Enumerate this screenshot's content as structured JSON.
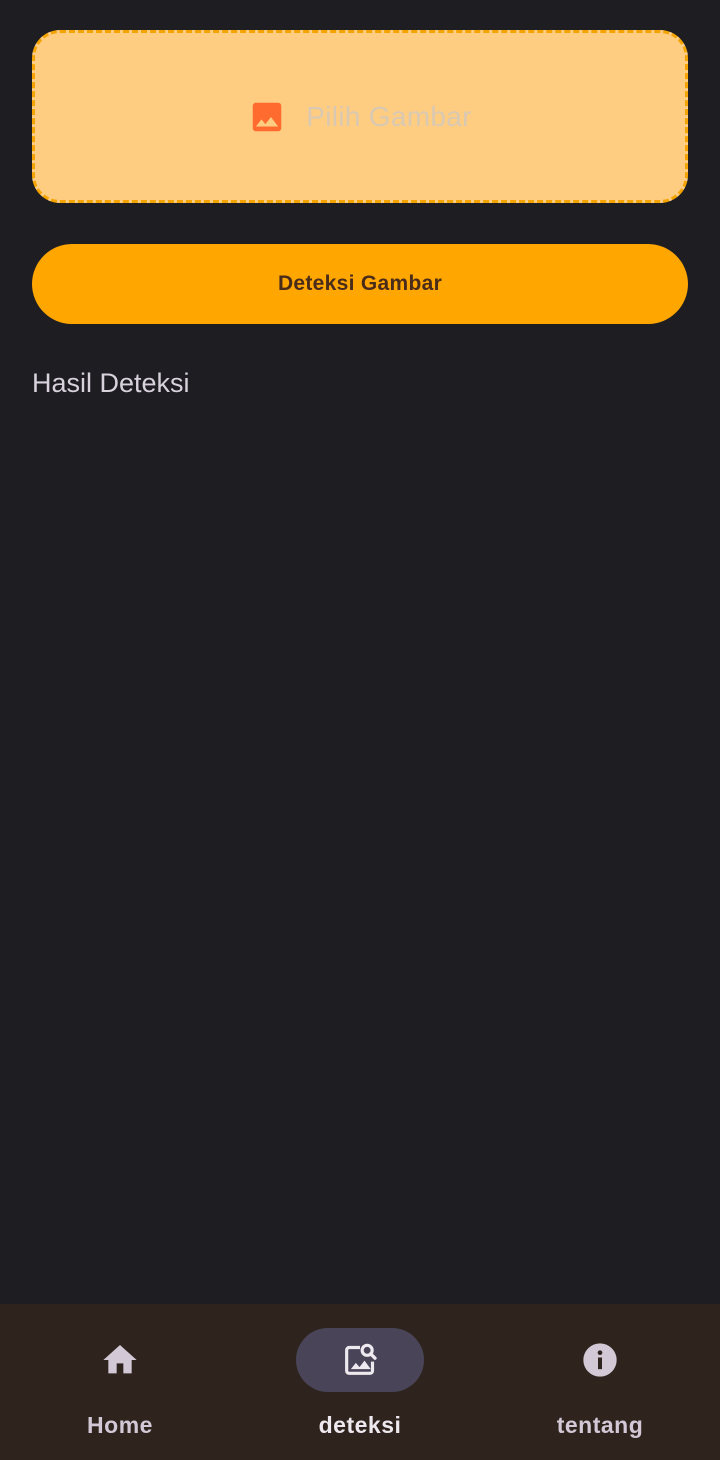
{
  "image_picker": {
    "icon": "image-icon",
    "label": "Pilih Gambar"
  },
  "detect_button": {
    "label": "Deteksi Gambar"
  },
  "result": {
    "title": "Hasil Deteksi"
  },
  "bottom_nav": {
    "items": [
      {
        "label": "Home",
        "icon": "home-icon",
        "active": false
      },
      {
        "label": "deteksi",
        "icon": "image-search-icon",
        "active": true
      },
      {
        "label": "tentang",
        "icon": "info-icon",
        "active": false
      }
    ]
  },
  "colors": {
    "background": "#1e1d22",
    "accent": "#ffa600",
    "picker_fill": "#ffcd82",
    "picker_border": "#f5a300",
    "picker_icon": "#ff6a2e",
    "nav_background": "#2e231d",
    "nav_indicator": "#4a4458"
  }
}
